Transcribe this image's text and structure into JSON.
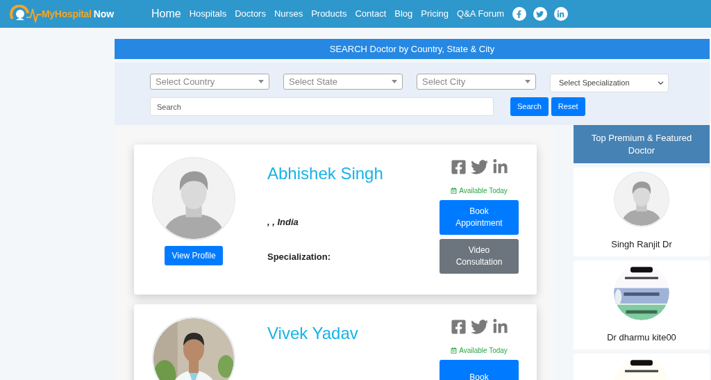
{
  "logo": {
    "brand": "MyHospital",
    "suffix": "Now"
  },
  "nav": [
    {
      "label": "Home",
      "selected": true
    },
    {
      "label": "Hospitals",
      "selected": false
    },
    {
      "label": "Doctors",
      "selected": false
    },
    {
      "label": "Nurses",
      "selected": false
    },
    {
      "label": "Products",
      "selected": false
    },
    {
      "label": "Contact",
      "selected": false
    },
    {
      "label": "Blog",
      "selected": false
    },
    {
      "label": "Pricing",
      "selected": false
    },
    {
      "label": "Q&A Forum",
      "selected": false
    }
  ],
  "header_social": [
    {
      "kind": "facebook"
    },
    {
      "kind": "twitter"
    },
    {
      "kind": "linkedin"
    }
  ],
  "search_panel": {
    "title": "SEARCH Doctor by Country, State & City",
    "selects": [
      {
        "kind": "combo",
        "placeholder": "Select Country"
      },
      {
        "kind": "combo",
        "placeholder": "Select State"
      },
      {
        "kind": "combo",
        "placeholder": "Select City"
      },
      {
        "kind": "native",
        "placeholder": "Select Specialization"
      }
    ],
    "search_field": {
      "placeholder": "Search"
    },
    "buttons": [
      "Search",
      "Reset"
    ]
  },
  "doctors": [
    {
      "name": "Abhishek Singh",
      "kind": "avatar",
      "location": ", , India",
      "specialization_label": "Specialization:",
      "availability": "Available Today",
      "view_profile": "View Profile",
      "actions": [
        {
          "kind": "primary",
          "label": "Book Appointment"
        },
        {
          "kind": "secondary",
          "label": "Video Consultation"
        }
      ]
    },
    {
      "name": "Vivek Yadav",
      "kind": "picture",
      "availability": "Available Today",
      "actions": [
        {
          "kind": "primary",
          "label": "Book"
        }
      ]
    }
  ],
  "sidebar": {
    "title": "Top Premium & Featured Doctor",
    "items": [
      {
        "name": "Singh Ranjit Dr",
        "kind": "avatar"
      },
      {
        "name": "Dr dharmu kite00",
        "kind": "picture"
      },
      {
        "kind": "picture"
      }
    ]
  }
}
